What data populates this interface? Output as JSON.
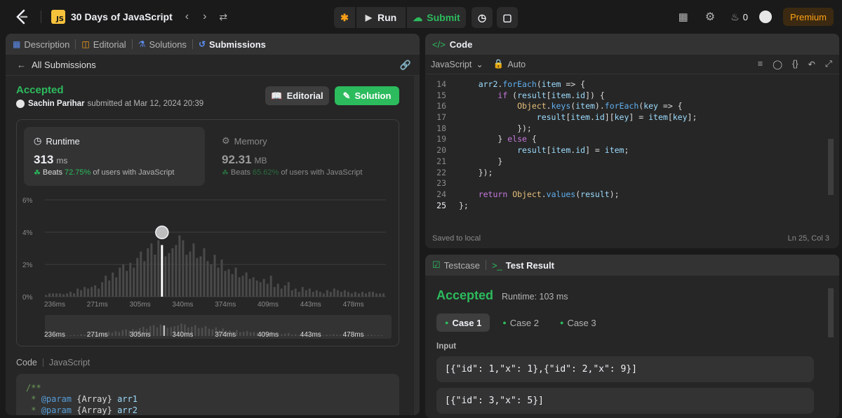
{
  "topbar": {
    "problem_list_title": "30 Days of JavaScript",
    "run_label": "Run",
    "submit_label": "Submit",
    "streak_count": "0",
    "premium_label": "Premium"
  },
  "left_panel": {
    "tabs": [
      {
        "label": "Description"
      },
      {
        "label": "Editorial"
      },
      {
        "label": "Solutions"
      },
      {
        "label": "Submissions"
      }
    ],
    "back_label": "All Submissions",
    "status": "Accepted",
    "user_name": "Sachin Parihar",
    "submitted_text": "submitted at Mar 12, 2024 20:39",
    "editorial_button": "Editorial",
    "solution_button": "Solution",
    "runtime": {
      "title": "Runtime",
      "value": "313",
      "unit": "ms",
      "beats_prefix": "Beats",
      "beats_pct": "72.75%",
      "beats_suffix": "of users with JavaScript"
    },
    "memory": {
      "title": "Memory",
      "value": "92.31",
      "unit": "MB",
      "beats_prefix": "Beats",
      "beats_pct": "65.62%",
      "beats_suffix": "of users with JavaScript"
    },
    "code_label": "Code",
    "code_lang": "JavaScript",
    "code_snippet": [
      "/**",
      " * @param {Array} arr1",
      " * @param {Array} arr2"
    ]
  },
  "chart_data": {
    "type": "bar",
    "ylim": [
      0,
      6
    ],
    "yticks": [
      "6%",
      "4%",
      "2%",
      "0%"
    ],
    "xticks": [
      "236ms",
      "271ms",
      "305ms",
      "340ms",
      "374ms",
      "409ms",
      "443ms",
      "478ms"
    ],
    "highlight_index": 33,
    "values": [
      0.1,
      0.2,
      0.2,
      0.2,
      0.2,
      0.15,
      0.2,
      0.3,
      0.2,
      0.5,
      0.4,
      0.6,
      0.5,
      0.6,
      0.7,
      0.5,
      0.9,
      1.3,
      1.0,
      1.5,
      1.2,
      1.8,
      2.0,
      1.6,
      2.1,
      1.8,
      2.4,
      2.8,
      2.2,
      3.0,
      3.3,
      2.6,
      3.5,
      3.2,
      2.5,
      2.7,
      3.0,
      3.2,
      3.8,
      3.5,
      2.6,
      2.8,
      3.3,
      2.4,
      2.5,
      3.0,
      2.2,
      2.0,
      2.6,
      1.8,
      2.3,
      1.6,
      1.7,
      1.4,
      1.8,
      1.2,
      1.3,
      1.5,
      1.1,
      1.2,
      1.0,
      0.9,
      1.1,
      0.8,
      1.3,
      0.6,
      0.8,
      0.5,
      0.7,
      0.9,
      0.4,
      0.5,
      0.3,
      0.6,
      0.4,
      0.5,
      0.3,
      0.4,
      0.3,
      0.2,
      0.4,
      0.3,
      0.5,
      0.4,
      0.3,
      0.4,
      0.3,
      0.2,
      0.3,
      0.2,
      0.3,
      0.2,
      0.3,
      0.3,
      0.2,
      0.2,
      0.2
    ]
  },
  "right_panel": {
    "code_tab": "Code",
    "language": "JavaScript",
    "mode": "Auto",
    "code_lines": [
      {
        "n": "14",
        "code": "    arr2.forEach(item => {"
      },
      {
        "n": "15",
        "code": "        if (result[item.id]) {"
      },
      {
        "n": "16",
        "code": "            Object.keys(item).forEach(key => {"
      },
      {
        "n": "17",
        "code": "                result[item.id][key] = item[key];"
      },
      {
        "n": "18",
        "code": "            });"
      },
      {
        "n": "19",
        "code": "        } else {"
      },
      {
        "n": "20",
        "code": "            result[item.id] = item;"
      },
      {
        "n": "21",
        "code": "        }"
      },
      {
        "n": "22",
        "code": "    });"
      },
      {
        "n": "23",
        "code": ""
      },
      {
        "n": "24",
        "code": "    return Object.values(result);"
      },
      {
        "n": "25",
        "code": "};"
      }
    ],
    "saved_text": "Saved to local",
    "cursor_pos": "Ln 25, Col 3",
    "testcase_tab": "Testcase",
    "testresult_tab": "Test Result",
    "result_status": "Accepted",
    "result_runtime": "Runtime: 103 ms",
    "cases": [
      "Case 1",
      "Case 2",
      "Case 3"
    ],
    "input_label": "Input",
    "inputs": [
      "[{\"id\": 1,\"x\": 1},{\"id\": 2,\"x\": 9}]",
      "[{\"id\": 3,\"x\": 5}]"
    ]
  },
  "colors": {
    "accent_green": "#2cbb5d",
    "premium": "#ffa116",
    "lang_js": "#f7c23b"
  }
}
